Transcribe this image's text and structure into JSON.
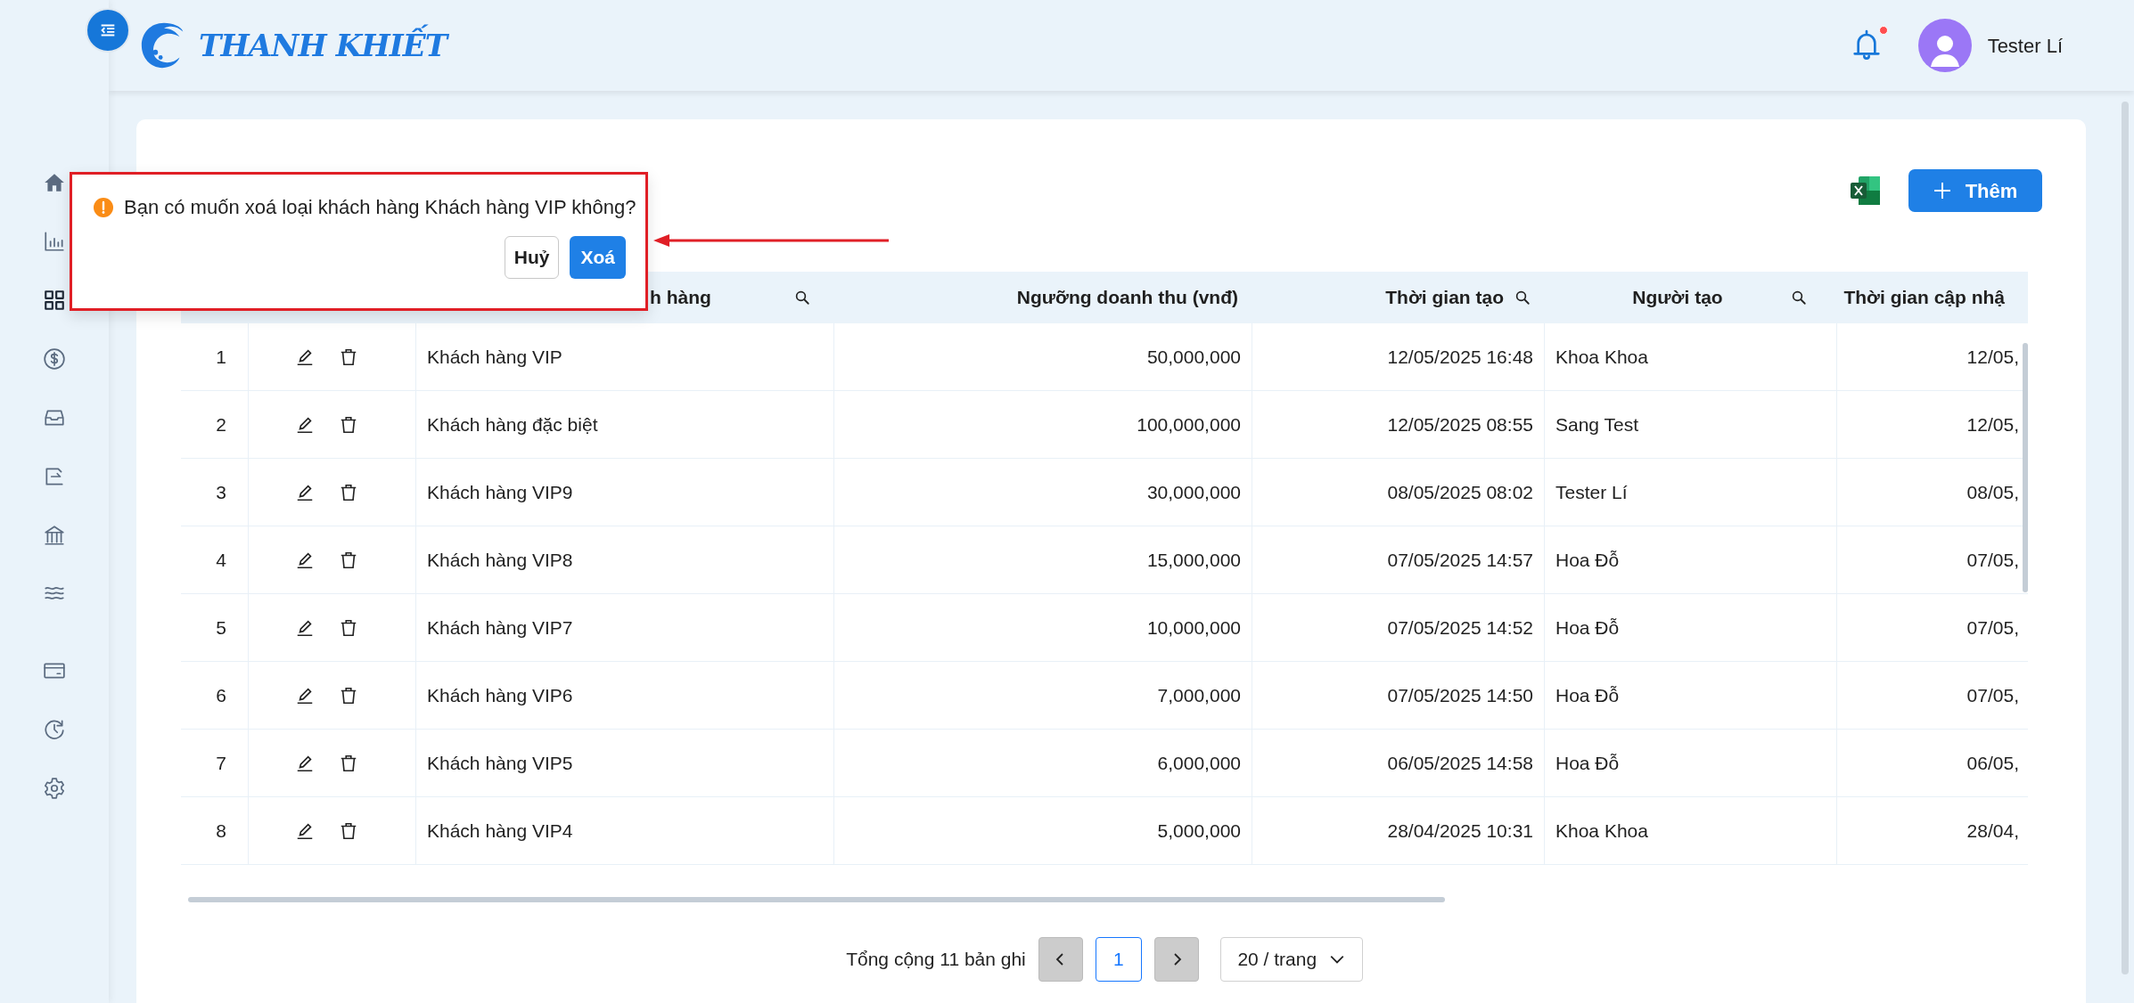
{
  "brand": {
    "name": "THANH KHIẾT"
  },
  "header": {
    "notification_unread": true,
    "user_name": "Tester Lí"
  },
  "toolbar": {
    "add_button": "Thêm"
  },
  "table": {
    "columns": [
      {
        "label": "h hàng"
      },
      {
        "label": "Ngưỡng doanh thu (vnđ)"
      },
      {
        "label": "Thời gian tạo"
      },
      {
        "label": "Người tạo"
      },
      {
        "label": "Thời gian cập nhậ"
      }
    ],
    "rows": [
      {
        "index": "1",
        "name": "Khách hàng VIP",
        "threshold": "50,000,000",
        "created": "12/05/2025 16:48",
        "creator": "Khoa Khoa",
        "updated": "12/05,"
      },
      {
        "index": "2",
        "name": "Khách hàng đặc biệt",
        "threshold": "100,000,000",
        "created": "12/05/2025 08:55",
        "creator": "Sang Test",
        "updated": "12/05,"
      },
      {
        "index": "3",
        "name": "Khách hàng VIP9",
        "threshold": "30,000,000",
        "created": "08/05/2025 08:02",
        "creator": "Tester Lí",
        "updated": "08/05,"
      },
      {
        "index": "4",
        "name": "Khách hàng VIP8",
        "threshold": "15,000,000",
        "created": "07/05/2025 14:57",
        "creator": "Hoa Đỗ",
        "updated": "07/05,"
      },
      {
        "index": "5",
        "name": "Khách hàng VIP7",
        "threshold": "10,000,000",
        "created": "07/05/2025 14:52",
        "creator": "Hoa Đỗ",
        "updated": "07/05,"
      },
      {
        "index": "6",
        "name": "Khách hàng VIP6",
        "threshold": "7,000,000",
        "created": "07/05/2025 14:50",
        "creator": "Hoa Đỗ",
        "updated": "07/05,"
      },
      {
        "index": "7",
        "name": "Khách hàng VIP5",
        "threshold": "6,000,000",
        "created": "06/05/2025 14:58",
        "creator": "Hoa Đỗ",
        "updated": "06/05,"
      },
      {
        "index": "8",
        "name": "Khách hàng VIP4",
        "threshold": "5,000,000",
        "created": "28/04/2025 10:31",
        "creator": "Khoa Khoa",
        "updated": "28/04,"
      }
    ]
  },
  "pagination": {
    "total": "Tổng cộng 11 bản ghi",
    "pages": [
      {
        "label": "1",
        "selected": true
      }
    ],
    "page_size": "20 / trang"
  },
  "popconfirm": {
    "message": "Bạn có muốn xoá loại khách hàng Khách hàng VIP không?",
    "cancel": "Huỷ",
    "confirm": "Xoá"
  }
}
